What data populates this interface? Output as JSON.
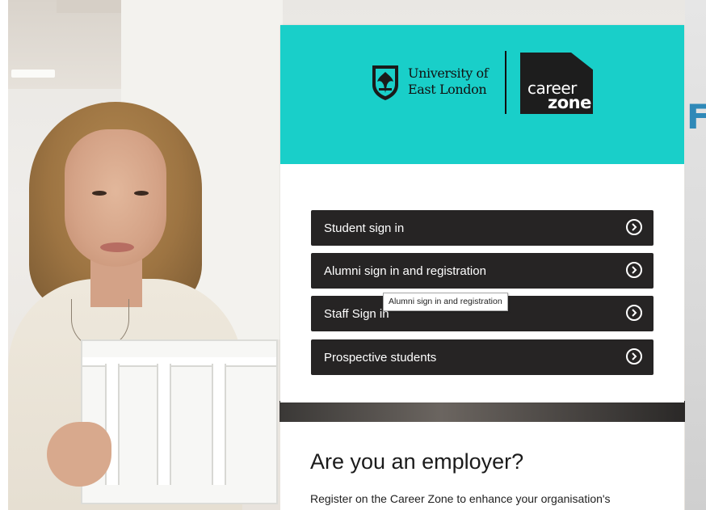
{
  "brand": {
    "university_line1": "University of",
    "university_line2": "East London",
    "career_word": "career",
    "zone_word": "zone",
    "accent_color": "#19cfc9",
    "button_color": "#262424"
  },
  "background": {
    "right_letter": "F"
  },
  "signin": {
    "buttons": [
      {
        "label": "Student sign in",
        "icon": "chevron-right-circle-icon"
      },
      {
        "label": "Alumni sign in and registration",
        "icon": "chevron-right-circle-icon"
      },
      {
        "label": "Staff Sign in",
        "icon": "chevron-right-circle-icon"
      },
      {
        "label": "Prospective students",
        "icon": "chevron-right-circle-icon"
      }
    ],
    "tooltip": "Alumni sign in and registration"
  },
  "employer": {
    "title": "Are you an employer?",
    "text": "Register on the Career Zone to enhance your organisation's"
  }
}
